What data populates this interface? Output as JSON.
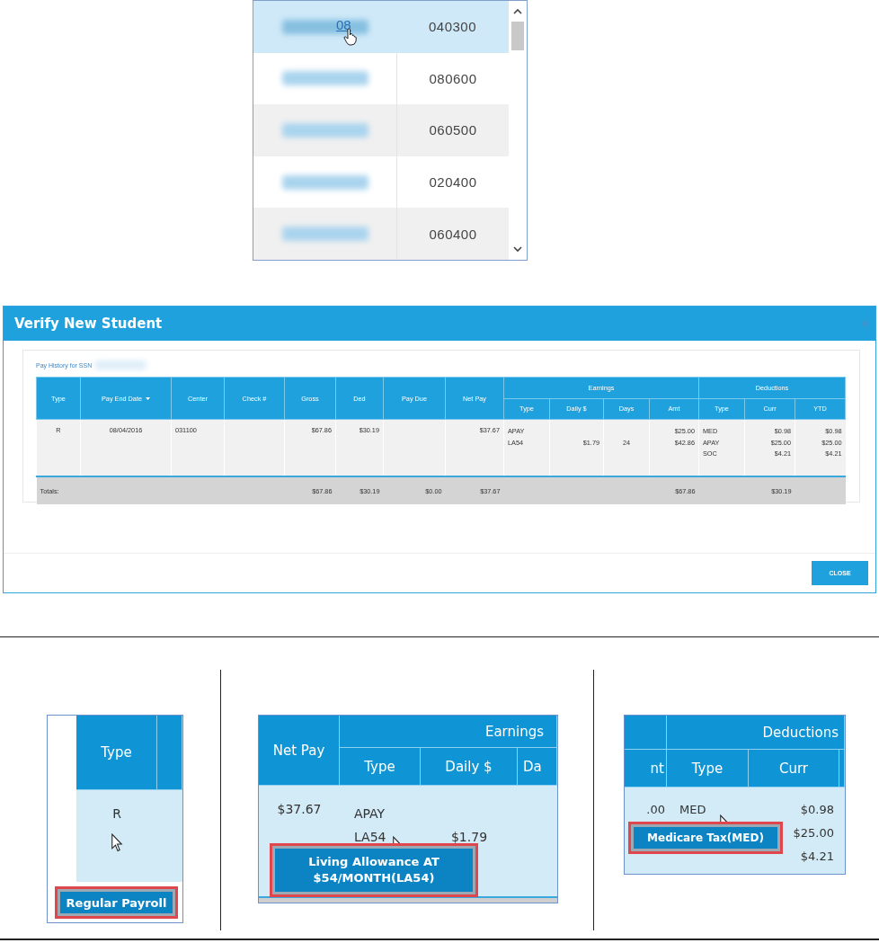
{
  "lookup_list": {
    "rows": [
      {
        "link_text": "08",
        "code": "040300",
        "selected": true
      },
      {
        "code": "080600",
        "selected": false
      },
      {
        "code": "060500",
        "selected": false
      },
      {
        "code": "020400",
        "selected": false
      },
      {
        "code": "060400",
        "selected": false
      }
    ]
  },
  "dialog": {
    "title": "Verify New Student",
    "caption": "Pay History for SSN",
    "columns": [
      {
        "label": "Type",
        "sorted": false
      },
      {
        "label": "Pay End Date",
        "sorted": true
      },
      {
        "label": "Center",
        "sorted": false
      },
      {
        "label": "Check #",
        "sorted": false
      },
      {
        "label": "Gross",
        "sorted": false
      },
      {
        "label": "Ded",
        "sorted": false
      },
      {
        "label": "Pay Due",
        "sorted": false
      },
      {
        "label": "Net Pay",
        "sorted": false
      }
    ],
    "groups": [
      {
        "label": "Earnings",
        "columns": [
          "Type",
          "Daily $",
          "Days",
          "Amt"
        ]
      },
      {
        "label": "Deductions",
        "columns": [
          "Type",
          "Curr",
          "YTD"
        ]
      }
    ],
    "row": {
      "type": "R",
      "pay_end_date": "08/04/2016",
      "center": "031100",
      "gross": "$67.86",
      "ded": "$30.19",
      "net_pay": "$37.67",
      "earnings": [
        {
          "type": "APAY",
          "amt": "$25.00"
        },
        {
          "type": "LA54",
          "daily": "$1.79",
          "days": "24",
          "amt": "$42.86"
        }
      ],
      "deductions": [
        {
          "type": "MED",
          "curr": "$0.98",
          "ytd": "$0.98"
        },
        {
          "type": "APAY",
          "curr": "$25.00",
          "ytd": "$25.00"
        },
        {
          "type": "SOC",
          "curr": "$4.21",
          "ytd": "$4.21"
        }
      ]
    },
    "totals": {
      "label": "Totals:",
      "gross": "$67.86",
      "ded": "$30.19",
      "pay_due": "$0.00",
      "net_pay": "$37.67",
      "earnings_amt": "$67.86",
      "deductions_curr": "$30.19"
    },
    "close_button": "CLOSE"
  },
  "callouts": [
    {
      "kind": "type-column",
      "header": "Type",
      "value": "R",
      "tooltip": "Regular Payroll"
    },
    {
      "kind": "earnings",
      "net_pay_header": "Net Pay",
      "group": "Earnings",
      "type_header": "Type",
      "daily_header": "Daily $",
      "days_header": "Da",
      "net_pay": "$37.67",
      "types": [
        "APAY",
        "LA54"
      ],
      "daily": "$1.79",
      "tooltip": "Living Allowance AT $54/MONTH(LA54)"
    },
    {
      "kind": "deductions",
      "group": "Deductions",
      "amt_header": "nt",
      "type_header": "Type",
      "curr_header": "Curr",
      "amt": ".00",
      "type": "MED",
      "curr": [
        "$0.98",
        "$25.00",
        "$4.21"
      ],
      "tooltip": "Medicare Tax(MED)"
    }
  ]
}
